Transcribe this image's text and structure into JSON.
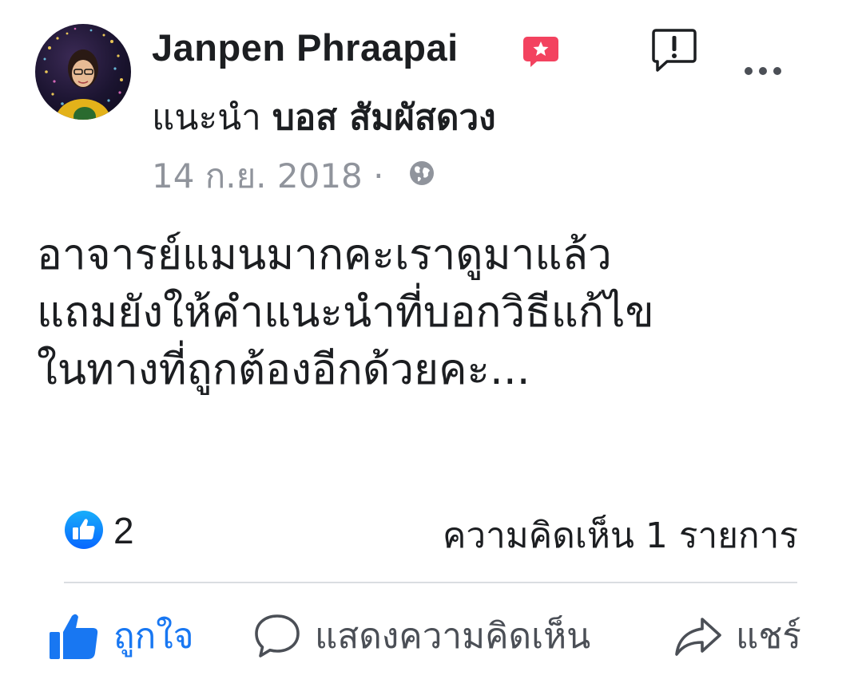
{
  "post": {
    "author": "Janpen Phraapai",
    "recommend_label": "แนะนำ",
    "recommend_target": "บอส สัมผัสดวง",
    "date": "14 ก.ย. 2018 ·",
    "body_lines": [
      "อาจารย์แมนมากคะเราดูมาแล้ว",
      "แถมยังให้คำแนะนำที่บอกวิธีแก้ไข",
      "ในทางที่ถูกต้องอีกด้วยคะ..."
    ]
  },
  "reactions": {
    "like_count": "2",
    "comment_count_text": "ความคิดเห็น 1 รายการ"
  },
  "actions": {
    "like_label": "ถูกใจ",
    "comment_label": "แสดงความคิดเห็น",
    "share_label": "แชร์"
  },
  "icons": {
    "badge": "recommendation-badge-icon",
    "report": "report-icon",
    "more": "more-options-icon",
    "privacy": "globe-icon",
    "like_reaction": "like-reaction-icon"
  },
  "colors": {
    "accent_blue": "#1877f2",
    "badge_red": "#f3425f",
    "muted_text": "#90949c",
    "icon_gray": "#4b4f56"
  }
}
